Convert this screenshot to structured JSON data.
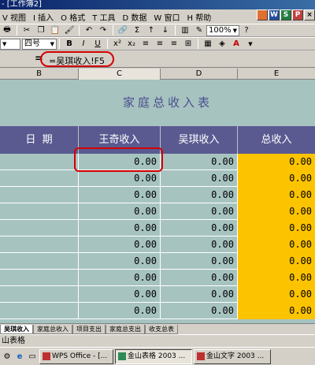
{
  "window": {
    "title": "- [工作簿2]"
  },
  "menu": [
    {
      "label": "V 视图"
    },
    {
      "label": "I 插入"
    },
    {
      "label": "O 格式"
    },
    {
      "label": "T 工具"
    },
    {
      "label": "D 数据"
    },
    {
      "label": "W 窗口"
    },
    {
      "label": "H 帮助"
    }
  ],
  "toolbar1": {
    "zoom": "100%"
  },
  "toolbar2": {
    "font_size": "四号",
    "bold": "B",
    "italic": "I",
    "underline": "U"
  },
  "formula": {
    "equals": "=",
    "content": "=吴琪收入!F5"
  },
  "columns": [
    "B",
    "C",
    "D",
    "E"
  ],
  "sheet": {
    "title": "家庭总收入表",
    "headers": [
      "日  期",
      "王奇收入",
      "吴琪收入",
      "总收入"
    ],
    "rows": [
      [
        "",
        "0.00",
        "0.00",
        "0.00"
      ],
      [
        "",
        "0.00",
        "0.00",
        "0.00"
      ],
      [
        "",
        "0.00",
        "0.00",
        "0.00"
      ],
      [
        "",
        "0.00",
        "0.00",
        "0.00"
      ],
      [
        "",
        "0.00",
        "0.00",
        "0.00"
      ],
      [
        "",
        "0.00",
        "0.00",
        "0.00"
      ],
      [
        "",
        "0.00",
        "0.00",
        "0.00"
      ],
      [
        "",
        "0.00",
        "0.00",
        "0.00"
      ],
      [
        "",
        "0.00",
        "0.00",
        "0.00"
      ],
      [
        "",
        "0.00",
        "0.00",
        "0.00"
      ]
    ]
  },
  "tabs": [
    "吴琪收入",
    "家庭总收入",
    "项目支出",
    "家庭总支出",
    "收支总表"
  ],
  "status": {
    "text": "山表格"
  },
  "taskbar": {
    "items": [
      "WPS Office - [...",
      "金山表格 2003 ...",
      "金山文字 2003 ..."
    ]
  },
  "colors": {
    "header_bg": "#5a5a91",
    "sheet_bg": "#a6c3c0",
    "total_fill": "#fcc300",
    "highlight": "#d40000"
  }
}
